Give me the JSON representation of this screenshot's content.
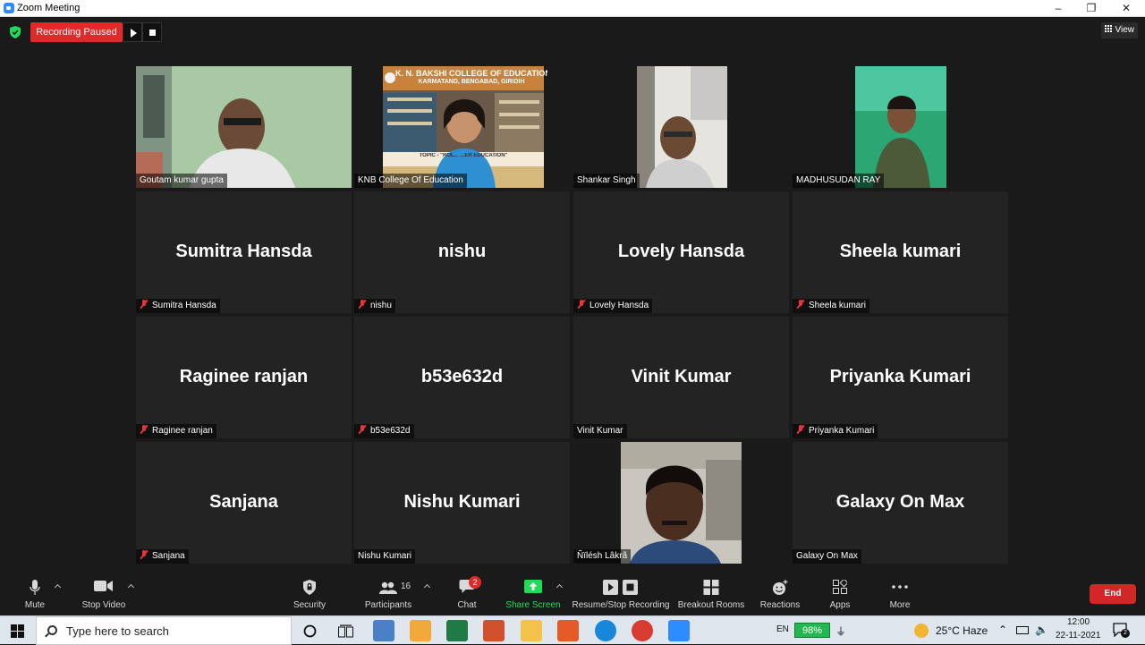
{
  "window": {
    "title": "Zoom Meeting",
    "minimize": "–",
    "maximize": "❐",
    "close": "✕"
  },
  "recording": {
    "status": "Recording Paused"
  },
  "view": {
    "label": "View"
  },
  "participants": [
    {
      "name": "Goutam kumar gupta",
      "video": true,
      "muted": false,
      "active": false
    },
    {
      "name": "KNB College Of Education",
      "video": true,
      "muted": false,
      "active": true
    },
    {
      "name": "Shankar Singh",
      "video": true,
      "muted": false,
      "active": false
    },
    {
      "name": "MADHUSUDAN RAY",
      "video": true,
      "muted": false,
      "active": false
    },
    {
      "name": "Sumitra Hansda",
      "video": false,
      "muted": true
    },
    {
      "name": "nishu",
      "video": false,
      "muted": true
    },
    {
      "name": "Lovely Hansda",
      "video": false,
      "muted": true
    },
    {
      "name": "Sheela kumari",
      "video": false,
      "muted": true
    },
    {
      "name": "Raginee ranjan",
      "video": false,
      "muted": true
    },
    {
      "name": "b53e632d",
      "video": false,
      "muted": true
    },
    {
      "name": "Vinit Kumar",
      "video": false,
      "muted": false
    },
    {
      "name": "Priyanka Kumari",
      "video": false,
      "muted": true
    },
    {
      "name": "Sanjana",
      "video": false,
      "muted": true
    },
    {
      "name": "Nishu Kumari",
      "video": false,
      "muted": false
    },
    {
      "name": "Ñïlésh Lâkrã",
      "video": true,
      "muted": false
    },
    {
      "name": "Galaxy On Max",
      "video": false,
      "muted": false
    }
  ],
  "slide": {
    "header": "K. N. BAKSHI COLLEGE OF EDUCATION",
    "subheader": "KARMATAND, BENGABAD, GIRIDIH",
    "topic": "TOPIC - \"ROL... ...ER EDUCATION\""
  },
  "toolbar": {
    "mute": "Mute",
    "stop_video": "Stop Video",
    "security": "Security",
    "participants": "Participants",
    "participants_count": "16",
    "chat": "Chat",
    "chat_badge": "2",
    "share_screen": "Share Screen",
    "recording": "Resume/Stop Recording",
    "breakout": "Breakout Rooms",
    "reactions": "Reactions",
    "apps": "Apps",
    "more": "More",
    "end": "End"
  },
  "taskbar": {
    "search_placeholder": "Type here to search",
    "weather": "25°C  Haze",
    "lang": "EN",
    "battery": "98%",
    "time": "12:00",
    "date": "22-11-2021",
    "notifications": "2"
  },
  "colors": {
    "accent": "#2d8cff",
    "record_red": "#e02a2a",
    "active_speaker": "#e9ea5a",
    "share_green": "#23d959",
    "end_red": "#d12727"
  }
}
